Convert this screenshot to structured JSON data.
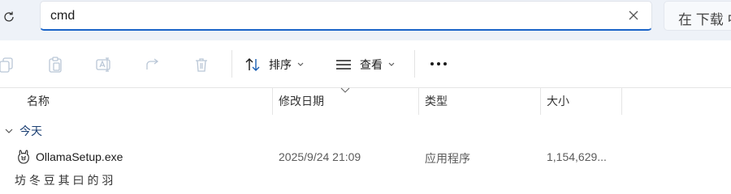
{
  "search": {
    "query": "cmd"
  },
  "right_search": {
    "text": "在 下载 中"
  },
  "toolbar": {
    "sort_label": "排序",
    "view_label": "查看",
    "icons": [
      "copy-icon",
      "paste-icon",
      "rename-icon",
      "share-icon",
      "delete-icon",
      "sort-icon",
      "view-icon",
      "more-icon"
    ]
  },
  "columns": [
    {
      "label": "名称"
    },
    {
      "label": "修改日期"
    },
    {
      "label": "类型"
    },
    {
      "label": "大小"
    }
  ],
  "group": {
    "label": "今天"
  },
  "files": [
    {
      "name": "OllamaSetup.exe",
      "modified": "2025/9/24 21:09",
      "type": "应用程序",
      "size": "1,154,629..."
    }
  ],
  "next_row_partial": "坊 冬 豆 其 曰 的 羽"
}
